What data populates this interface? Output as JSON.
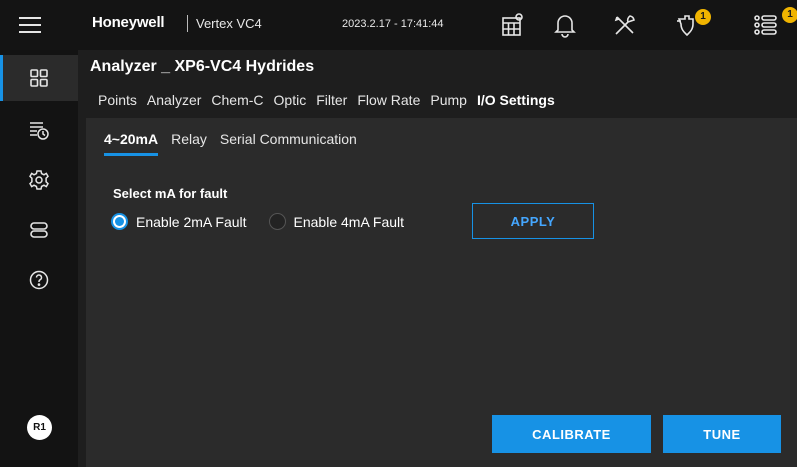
{
  "header": {
    "brand": "Honeywell",
    "product": "Vertex VC4",
    "datetime": "2023.2.17 - 17:41:44",
    "maintenance_badge": "1",
    "events_badge": "1",
    "icons": [
      "menu-icon",
      "calendar-settings-icon",
      "bell-icon",
      "tools-icon",
      "maintenance-icon",
      "event-list-icon"
    ]
  },
  "sidebar": {
    "items": [
      "dashboard-icon",
      "event-history-icon",
      "settings-icon",
      "devices-icon",
      "help-icon"
    ],
    "active_index": 0,
    "user_initials": "R1"
  },
  "page": {
    "title": "Analyzer _ XP6-VC4 Hydrides",
    "tabs": [
      "Points",
      "Analyzer",
      "Chem-C",
      "Optic",
      "Filter",
      "Flow Rate",
      "Pump",
      "I/O Settings"
    ],
    "active_tab": "I/O Settings",
    "subtabs": [
      "4~20mA",
      "Relay",
      "Serial Communication"
    ],
    "active_subtab": "4~20mA"
  },
  "fault": {
    "label": "Select mA for fault",
    "options": [
      "Enable 2mA Fault",
      "Enable 4mA Fault"
    ],
    "selected": "Enable 2mA Fault",
    "apply_label": "APPLY"
  },
  "actions": {
    "calibrate_label": "CALIBRATE",
    "tune_label": "TUNE"
  },
  "colors": {
    "accent": "#1792e5",
    "badge": "#f0b400",
    "background": "#1e1e1e",
    "panel": "#2b2b2b"
  }
}
